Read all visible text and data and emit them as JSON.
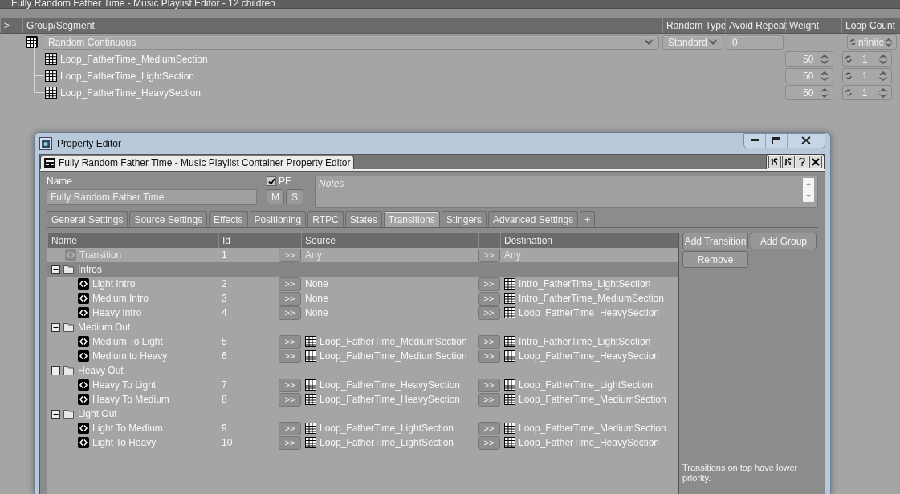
{
  "editor_title": "Fully Random Father Time - Music Playlist Editor - 12 children",
  "playlist": {
    "columns": [
      ">",
      "Group/Segment",
      "Random Type",
      "Avoid Repeat",
      "Weight",
      "Loop Count"
    ],
    "root": {
      "name": "Random Continuous",
      "random_type": "Standard",
      "avoid_repeat": "0",
      "loop_count": "Infinite",
      "children": [
        {
          "name": "Loop_FatherTime_MediumSection",
          "weight": "50",
          "loop_count": "1"
        },
        {
          "name": "Loop_FatherTime_LightSection",
          "weight": "50",
          "loop_count": "1"
        },
        {
          "name": "Loop_FatherTime_HeavySection",
          "weight": "50",
          "loop_count": "1"
        }
      ]
    }
  },
  "property_editor": {
    "window_title": "Property Editor",
    "doc_tab": "Fully Random Father Time - Music Playlist Container Property Editor",
    "name_label": "Name",
    "name_value": "Fully Random Father Time",
    "pf": {
      "label": "PF",
      "checked": true
    },
    "buttons": [
      "M",
      "S"
    ],
    "notes_placeholder": "Notes",
    "tabs": [
      {
        "label": "General Settings",
        "selected": false
      },
      {
        "label": "Source Settings",
        "selected": false
      },
      {
        "label": "Effects",
        "selected": false
      },
      {
        "label": "Positioning",
        "selected": false
      },
      {
        "label": "RTPC",
        "selected": false
      },
      {
        "label": "States",
        "selected": false
      },
      {
        "label": "Transitions",
        "selected": true
      },
      {
        "label": "Stingers",
        "selected": false
      },
      {
        "label": "Advanced Settings",
        "selected": false
      },
      {
        "label": "+",
        "selected": false
      }
    ],
    "transitions": {
      "columns": [
        "Name",
        "Id",
        "Source",
        "Destination"
      ],
      "rows": [
        {
          "kind": "transition",
          "name": "Transition",
          "id": "1",
          "disabled": true,
          "selected": false,
          "source_button": ">>",
          "source": {
            "kind": "plain",
            "name": "Any"
          },
          "destination_button": ">>",
          "destination": {
            "kind": "plain",
            "name": "Any"
          }
        },
        {
          "kind": "group",
          "name": "Intros",
          "expanded": true,
          "selected": true,
          "children": [
            {
              "kind": "transition",
              "name": "Light Intro",
              "id": "2",
              "disabled": false,
              "selected": false,
              "source_button": ">>",
              "source": {
                "kind": "plain",
                "name": "None"
              },
              "destination_button": ">>",
              "destination": {
                "kind": "segment",
                "name": "Intro_FatherTime_LightSection"
              }
            },
            {
              "kind": "transition",
              "name": "Medium Intro",
              "id": "3",
              "disabled": false,
              "selected": false,
              "source_button": ">>",
              "source": {
                "kind": "plain",
                "name": "None"
              },
              "destination_button": ">>",
              "destination": {
                "kind": "segment",
                "name": "Intro_FatherTime_MediumSection"
              }
            },
            {
              "kind": "transition",
              "name": "Heavy Intro",
              "id": "4",
              "disabled": false,
              "selected": false,
              "source_button": ">>",
              "source": {
                "kind": "plain",
                "name": "None"
              },
              "destination_button": ">>",
              "destination": {
                "kind": "segment",
                "name": "Loop_FatherTime_HeavySection"
              }
            }
          ]
        },
        {
          "kind": "group",
          "name": "Medium Out",
          "expanded": true,
          "selected": false,
          "children": [
            {
              "kind": "transition",
              "name": "Medium To Light",
              "id": "5",
              "disabled": false,
              "selected": false,
              "source_button": ">>",
              "source": {
                "kind": "segment",
                "name": "Loop_FatherTime_MediumSection"
              },
              "destination_button": ">>",
              "destination": {
                "kind": "segment",
                "name": "Intro_FatherTime_LightSection"
              }
            },
            {
              "kind": "transition",
              "name": "Medium to Heavy",
              "id": "6",
              "disabled": false,
              "selected": false,
              "source_button": ">>",
              "source": {
                "kind": "segment",
                "name": "Loop_FatherTime_MediumSection"
              },
              "destination_button": ">>",
              "destination": {
                "kind": "segment",
                "name": "Loop_FatherTime_HeavySection"
              }
            }
          ]
        },
        {
          "kind": "group",
          "name": "Heavy Out",
          "expanded": true,
          "selected": false,
          "children": [
            {
              "kind": "transition",
              "name": "Heavy To Light",
              "id": "7",
              "disabled": false,
              "selected": false,
              "source_button": ">>",
              "source": {
                "kind": "segment",
                "name": "Loop_FatherTime_HeavySection"
              },
              "destination_button": ">>",
              "destination": {
                "kind": "segment",
                "name": "Loop_FatherTime_LightSection"
              }
            },
            {
              "kind": "transition",
              "name": "Heavy To Medium",
              "id": "8",
              "disabled": false,
              "selected": false,
              "source_button": ">>",
              "source": {
                "kind": "segment",
                "name": "Loop_FatherTime_HeavySection"
              },
              "destination_button": ">>",
              "destination": {
                "kind": "segment",
                "name": "Loop_FatherTime_MediumSection"
              }
            }
          ]
        },
        {
          "kind": "group",
          "name": "Light Out",
          "expanded": true,
          "selected": false,
          "children": [
            {
              "kind": "transition",
              "name": "Light To Medium",
              "id": "9",
              "disabled": false,
              "selected": false,
              "source_button": ">>",
              "source": {
                "kind": "segment",
                "name": "Loop_FatherTime_LightSection"
              },
              "destination_button": ">>",
              "destination": {
                "kind": "segment",
                "name": "Loop_FatherTime_MediumSection"
              }
            },
            {
              "kind": "transition",
              "name": "Light To Heavy",
              "id": "10",
              "disabled": false,
              "selected": false,
              "source_button": ">>",
              "source": {
                "kind": "segment",
                "name": "Loop_FatherTime_LightSection"
              },
              "destination_button": ">>",
              "destination": {
                "kind": "segment",
                "name": "Loop_FatherTime_HeavySection"
              }
            }
          ]
        }
      ]
    },
    "actions": [
      "Add Transition",
      "Add Group",
      "Remove"
    ],
    "hint": "Transitions on top have lower priority."
  }
}
